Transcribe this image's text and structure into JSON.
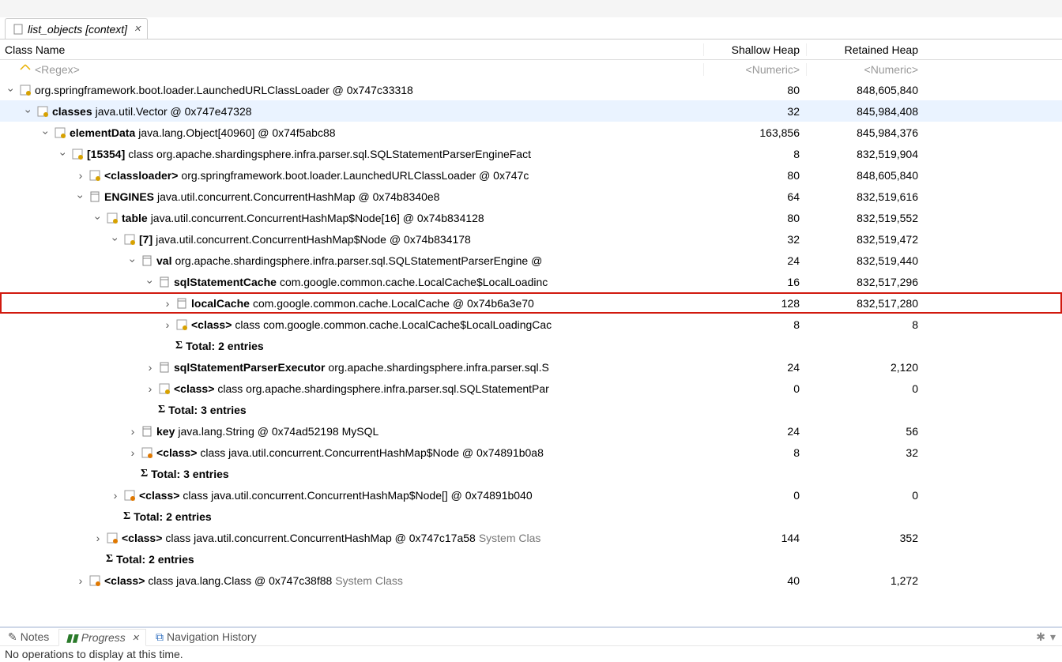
{
  "tab": {
    "title": "list_objects [context]"
  },
  "columns": {
    "name": "Class Name",
    "shallow": "Shallow Heap",
    "retained": "Retained Heap"
  },
  "filters": {
    "regex_placeholder": "<Regex>",
    "numeric_placeholder": "<Numeric>"
  },
  "rows": [
    {
      "indent": 0,
      "twisty": "open",
      "icon": "cls",
      "boldLabel": "",
      "text": "org.springframework.boot.loader.LaunchedURLClassLoader @ 0x747c33318",
      "sh": "80",
      "rh": "848,605,840"
    },
    {
      "indent": 1,
      "twisty": "open",
      "icon": "cls",
      "boldLabel": "classes",
      "text": " java.util.Vector @ 0x747e47328",
      "sh": "32",
      "rh": "845,984,408",
      "sel": true
    },
    {
      "indent": 2,
      "twisty": "open",
      "icon": "cls",
      "boldLabel": "elementData",
      "text": " java.lang.Object[40960] @ 0x74f5abc88",
      "sh": "163,856",
      "rh": "845,984,376"
    },
    {
      "indent": 3,
      "twisty": "open",
      "icon": "cls",
      "boldLabel": "[15354]",
      "text": " class org.apache.shardingsphere.infra.parser.sql.SQLStatementParserEngineFact",
      "sh": "8",
      "rh": "832,519,904"
    },
    {
      "indent": 4,
      "twisty": "closed",
      "icon": "cls",
      "boldLabel": "<classloader>",
      "text": " org.springframework.boot.loader.LaunchedURLClassLoader @ 0x747c",
      "sh": "80",
      "rh": "848,605,840"
    },
    {
      "indent": 4,
      "twisty": "open",
      "icon": "file",
      "boldLabel": "ENGINES",
      "text": " java.util.concurrent.ConcurrentHashMap @ 0x74b8340e8",
      "sh": "64",
      "rh": "832,519,616"
    },
    {
      "indent": 5,
      "twisty": "open",
      "icon": "cls",
      "boldLabel": "table",
      "text": " java.util.concurrent.ConcurrentHashMap$Node[16] @ 0x74b834128",
      "sh": "80",
      "rh": "832,519,552"
    },
    {
      "indent": 6,
      "twisty": "open",
      "icon": "cls",
      "boldLabel": "[7]",
      "text": " java.util.concurrent.ConcurrentHashMap$Node @ 0x74b834178",
      "sh": "32",
      "rh": "832,519,472"
    },
    {
      "indent": 7,
      "twisty": "open",
      "icon": "file",
      "boldLabel": "val",
      "text": " org.apache.shardingsphere.infra.parser.sql.SQLStatementParserEngine @",
      "sh": "24",
      "rh": "832,519,440"
    },
    {
      "indent": 8,
      "twisty": "open",
      "icon": "file",
      "boldLabel": "sqlStatementCache",
      "text": " com.google.common.cache.LocalCache$LocalLoadinc",
      "sh": "16",
      "rh": "832,517,296"
    },
    {
      "indent": 9,
      "twisty": "closed",
      "icon": "file",
      "boldLabel": "localCache",
      "text": " com.google.common.cache.LocalCache @ 0x74b6a3e70",
      "sh": "128",
      "rh": "832,517,280",
      "hl": true
    },
    {
      "indent": 9,
      "twisty": "closed",
      "icon": "cls",
      "boldLabel": "<class>",
      "text": " class com.google.common.cache.LocalCache$LocalLoadingCac",
      "sh": "8",
      "rh": "8"
    },
    {
      "indent": 9,
      "twisty": "none",
      "icon": "sigma",
      "boldLabel": "Total: 2 entries",
      "text": "",
      "sh": "",
      "rh": ""
    },
    {
      "indent": 8,
      "twisty": "closed",
      "icon": "file",
      "boldLabel": "sqlStatementParserExecutor",
      "text": " org.apache.shardingsphere.infra.parser.sql.S",
      "sh": "24",
      "rh": "2,120"
    },
    {
      "indent": 8,
      "twisty": "closed",
      "icon": "cls",
      "boldLabel": "<class>",
      "text": " class org.apache.shardingsphere.infra.parser.sql.SQLStatementPar",
      "sh": "0",
      "rh": "0"
    },
    {
      "indent": 8,
      "twisty": "none",
      "icon": "sigma",
      "boldLabel": "Total: 3 entries",
      "text": "",
      "sh": "",
      "rh": ""
    },
    {
      "indent": 7,
      "twisty": "closed",
      "icon": "file",
      "boldLabel": "key",
      "text": " java.lang.String @ 0x74ad52198  MySQL",
      "sh": "24",
      "rh": "56"
    },
    {
      "indent": 7,
      "twisty": "closed",
      "icon": "clsO",
      "boldLabel": "<class>",
      "text": " class java.util.concurrent.ConcurrentHashMap$Node @ 0x74891b0a8",
      "sh": "8",
      "rh": "32"
    },
    {
      "indent": 7,
      "twisty": "none",
      "icon": "sigma",
      "boldLabel": "Total: 3 entries",
      "text": "",
      "sh": "",
      "rh": ""
    },
    {
      "indent": 6,
      "twisty": "closed",
      "icon": "clsO",
      "boldLabel": "<class>",
      "text": " class java.util.concurrent.ConcurrentHashMap$Node[] @ 0x74891b040",
      "sh": "0",
      "rh": "0"
    },
    {
      "indent": 6,
      "twisty": "none",
      "icon": "sigma",
      "boldLabel": "Total: 2 entries",
      "text": "",
      "sh": "",
      "rh": ""
    },
    {
      "indent": 5,
      "twisty": "closed",
      "icon": "clsO",
      "boldLabel": "<class>",
      "text": " class java.util.concurrent.ConcurrentHashMap @ 0x747c17a58 ",
      "gray": "System Clas",
      "sh": "144",
      "rh": "352"
    },
    {
      "indent": 5,
      "twisty": "none",
      "icon": "sigma",
      "boldLabel": "Total: 2 entries",
      "text": "",
      "sh": "",
      "rh": ""
    },
    {
      "indent": 4,
      "twisty": "closed",
      "icon": "clsO",
      "boldLabel": "<class>",
      "text": " class java.lang.Class @ 0x747c38f88 ",
      "gray": "System Class",
      "sh": "40",
      "rh": "1,272"
    }
  ],
  "bottom": {
    "tabs": {
      "notes": "Notes",
      "progress": "Progress",
      "history": "Navigation History"
    },
    "message": "No operations to display at this time."
  }
}
